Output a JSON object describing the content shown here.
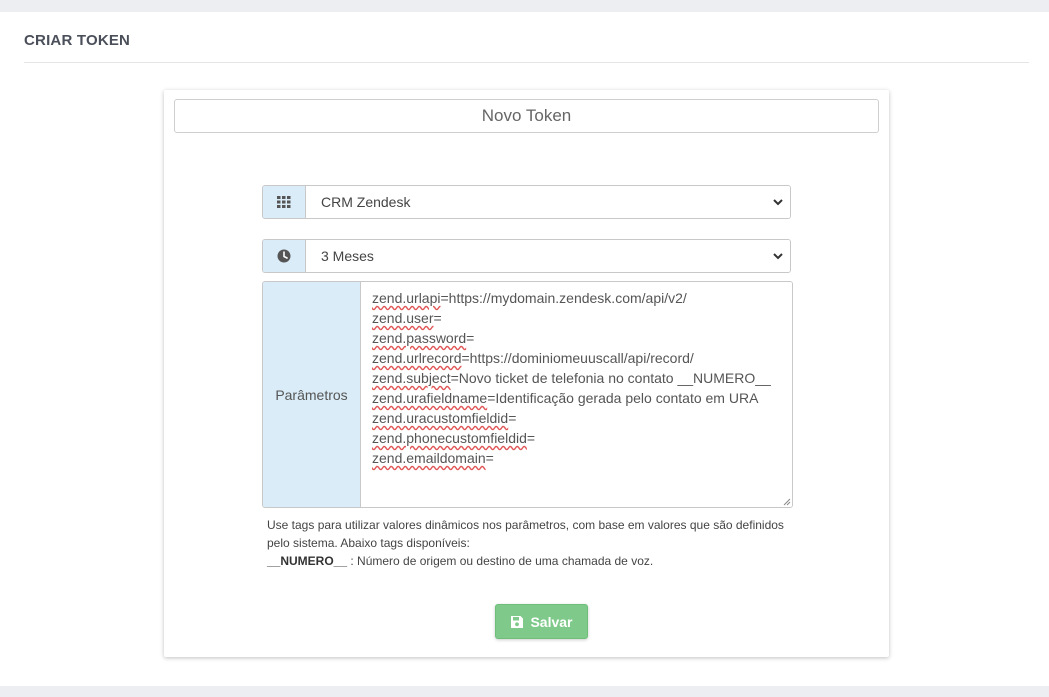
{
  "page": {
    "title": "CRIAR TOKEN"
  },
  "form": {
    "token_name": "Novo Token",
    "crm_select": {
      "value": "CRM Zendesk",
      "icon": "grid-icon"
    },
    "period_select": {
      "value": "3 Meses",
      "icon": "clock-icon"
    },
    "params_label": "Parâmetros",
    "params_lines": [
      {
        "key": "zend.urlapi",
        "rest": "=https://mydomain.zendesk.com/api/v2/"
      },
      {
        "key": "zend.user",
        "rest": "="
      },
      {
        "key": "zend.password",
        "rest": "="
      },
      {
        "key": "zend.urlrecord",
        "rest": "=https://dominiomeuuscall/api/record/"
      },
      {
        "key": "zend.subject",
        "rest": "=Novo ticket de telefonia no contato __NUMERO__"
      },
      {
        "key": "zend.urafieldname",
        "rest": "=Identificação gerada pelo contato em URA"
      },
      {
        "key": "zend.uracustomfieldid",
        "rest": "="
      },
      {
        "key": "zend.phonecustomfieldid",
        "rest": "="
      },
      {
        "key": "zend.emaildomain",
        "rest": "="
      }
    ],
    "help_line1": "Use tags para utilizar valores dinâmicos nos parâmetros, com base em valores que são definidos",
    "help_line2": "pelo sistema. Abaixo tags disponíveis:",
    "help_tag": "__NUMERO__",
    "help_tag_desc": " : Número de origem ou destino de uma chamada de voz.",
    "save_label": "Salvar"
  },
  "colors": {
    "addon_bg": "#d9ecf7",
    "save_btn": "#7fc98a"
  }
}
